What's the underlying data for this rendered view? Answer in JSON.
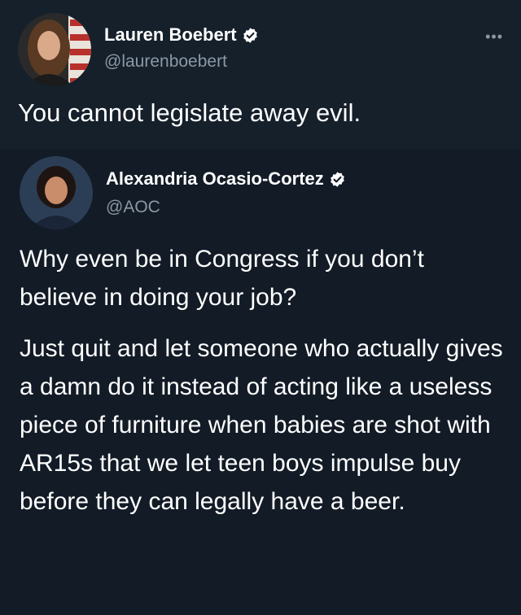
{
  "tweet": {
    "author_name": "Lauren Boebert",
    "author_handle": "@laurenboebert",
    "more_label": "•••",
    "text": "You cannot legislate away evil."
  },
  "quoted_tweet": {
    "author_name": "Alexandria Ocasio-Cortez",
    "author_handle": "@AOC",
    "paragraph_1": "Why even be in Congress if you don’t believe in doing your job?",
    "paragraph_2": "Just quit and let someone who actually gives a damn do it instead of acting like a useless piece of furniture when babies are shot with AR15s that we let teen boys impulse buy before they can legally have a beer."
  },
  "icons": {
    "verified": "verified-badge-icon",
    "more": "more-options-icon"
  },
  "colors": {
    "background": "#15202b",
    "quote_background": "#121b26",
    "text": "#ffffff",
    "secondary_text": "#8b98a5",
    "verified_badge": "#ffffff"
  }
}
